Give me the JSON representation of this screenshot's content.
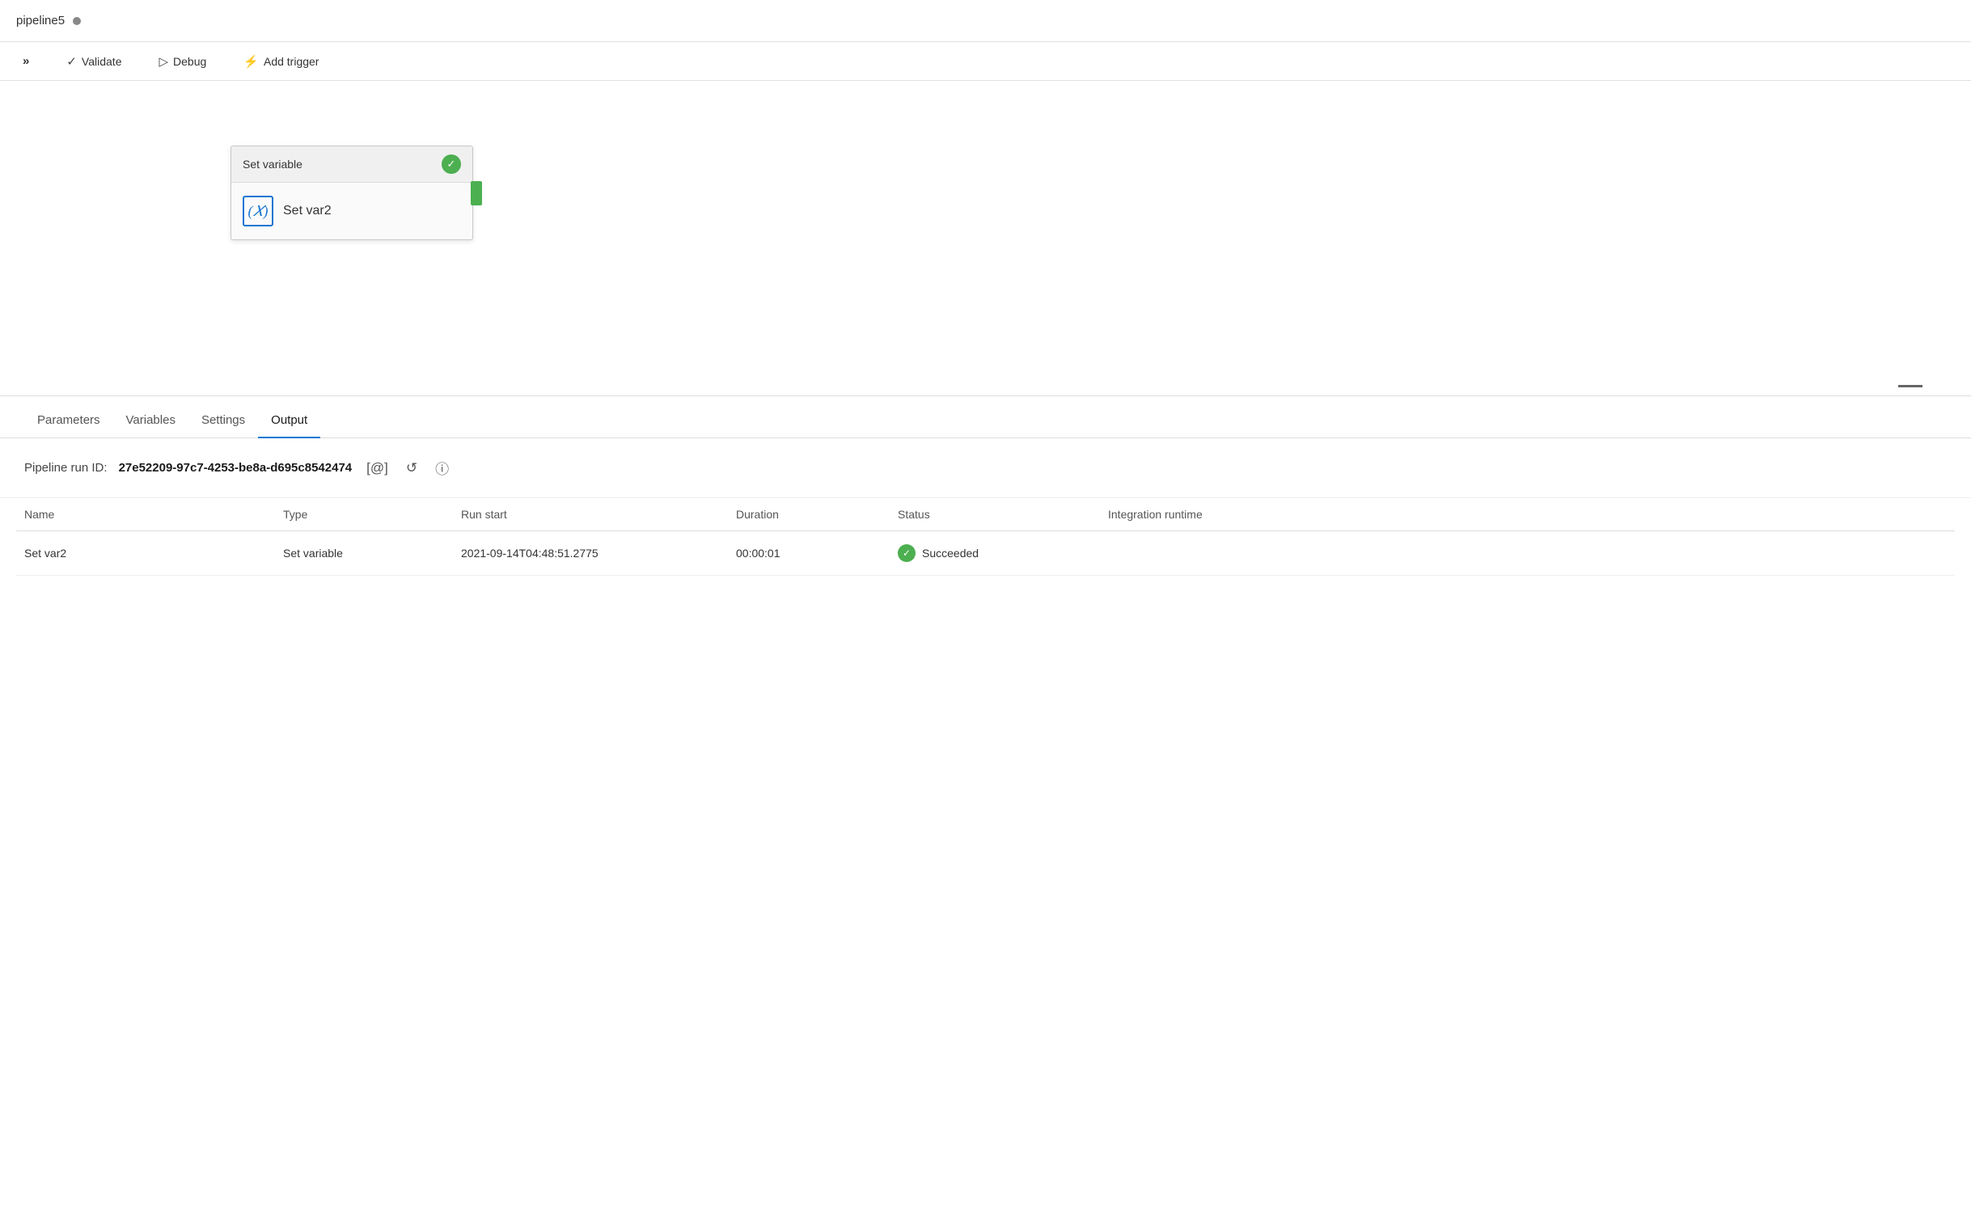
{
  "header": {
    "pipeline_name": "pipeline5",
    "dot_status": "unsaved"
  },
  "toolbar": {
    "chevron_label": "»",
    "validate_label": "Validate",
    "debug_label": "Debug",
    "add_trigger_label": "Add trigger"
  },
  "canvas": {
    "node": {
      "header": "Set variable",
      "name": "Set var2",
      "variable_icon": "X",
      "success_icon": "✓"
    }
  },
  "bottom_panel": {
    "tabs": [
      {
        "id": "parameters",
        "label": "Parameters",
        "active": false
      },
      {
        "id": "variables",
        "label": "Variables",
        "active": false
      },
      {
        "id": "settings",
        "label": "Settings",
        "active": false
      },
      {
        "id": "output",
        "label": "Output",
        "active": true
      }
    ],
    "run_info": {
      "label": "Pipeline run ID:",
      "run_id": "27e52209-97c7-4253-be8a-d695c8542474"
    },
    "table": {
      "columns": [
        "Name",
        "Type",
        "Run start",
        "Duration",
        "Status",
        "Integration runtime"
      ],
      "rows": [
        {
          "name": "Set var2",
          "type": "Set variable",
          "run_start": "2021-09-14T04:48:51.2775",
          "duration": "00:00:01",
          "status": "Succeeded",
          "integration_runtime": ""
        }
      ]
    }
  },
  "icons": {
    "checkmark": "✓",
    "validate": "✓",
    "debug": "▷",
    "trigger": "⚡",
    "copy": "[@]",
    "refresh": "↺",
    "info": "ⓘ"
  }
}
